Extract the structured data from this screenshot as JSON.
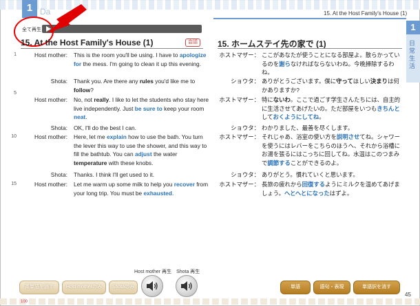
{
  "header": {
    "day_number": "1",
    "day_label": "Da",
    "play_all": "全て再生",
    "page_title_right": "15. At the Host Family's House (1)"
  },
  "side_tab": {
    "number": "1",
    "text": "日常生活"
  },
  "english": {
    "title": "15. At the Host Family's House (1)",
    "badge": "会話",
    "rows": [
      {
        "ln": "1",
        "speaker": "Host mother:",
        "t1": "This is the room you'll be using. I have to ",
        "t2": "apologize for",
        "t3": " the mess. I'm going to clean it up this evening."
      },
      {
        "ln": "",
        "speaker": "Shota:",
        "t1": "Thank you. Are there any ",
        "t2": "rules",
        "t3": " you'd like me to ",
        "t4": "follow",
        "t5": "?"
      },
      {
        "ln": "5",
        "speaker": "Host mother:",
        "t1": "No, not ",
        "t2": "really",
        "t3": ". I like to let the students who stay here live independently. Just ",
        "t4": "be sure to",
        "t5": " keep your room ",
        "t6": "neat",
        "t7": "."
      },
      {
        "ln": "",
        "speaker": "Shota:",
        "t1": "OK, I'll do the best I can."
      },
      {
        "ln": "10",
        "speaker": "Host mother:",
        "t1": "Here, let me ",
        "t2": "explain",
        "t3": " how to use the bath. You turn the lever this way to use the shower, and this way to fill the bathtub. You can ",
        "t4": "adjust",
        "t5": " the water ",
        "t6": "temperature",
        "t7": " with these knobs."
      },
      {
        "ln": "",
        "speaker": "Shota:",
        "t1": "Thanks. I think I'll get used to it."
      },
      {
        "ln": "15",
        "speaker": "Host mother:",
        "t1": "Let me warm up some milk to help you ",
        "t2": "recover",
        "t3": " from your long trip. You must be ",
        "t4": "exhausted",
        "t5": "."
      }
    ]
  },
  "japanese": {
    "title": "15. ホームステイ先の家で (1)",
    "rows": [
      {
        "speaker": "ホストマザー：",
        "t1": "ここがあなたが使うことになる部屋よ。散らかっているのを",
        "t2": "謝ら",
        "t3": "なければならないわね。今晩掃除するわね。"
      },
      {
        "speaker": "ショウタ：",
        "t1": "ありがとうございます。僕に",
        "t2": "守って",
        "t3": "ほしい",
        "t4": "決まり",
        "t5": "は何かありますか?"
      },
      {
        "speaker": "ホストマザー：",
        "t1": "特に",
        "t2": "ないわ",
        "t3": "。ここで過ごす学生さんたちには、自主的に生活させてあげたいの。ただ部屋をいつも",
        "t4": "きちんと",
        "t5": "して",
        "t6": "おくようにしてね",
        "t7": "。"
      },
      {
        "speaker": "ショウタ：",
        "t1": "わかりました、最善を尽くします。"
      },
      {
        "speaker": "ホストマザー：",
        "t1": "それじゃあ、浴室の使い方を",
        "t2": "説明させ",
        "t3": "てね。シャワーを使うにはレバーをこちらのほうへ、それから浴槽にお湯を張るにはこっちに回してね。水温はこのつまみで",
        "t4": "調節する",
        "t5": "ことができるのよ。"
      },
      {
        "speaker": "ショウタ：",
        "t1": "ありがとう。慣れていくと思います。"
      },
      {
        "speaker": "ホストマザー：",
        "t1": "長旅の疲れから",
        "t2": "回復する",
        "t3": "ようにミルクを温めてあげましょう。",
        "t4": "へとへとになった",
        "t5": "はずよ。"
      }
    ]
  },
  "bottom": {
    "caption": "Host mother 再生　Shota 再生",
    "buttons_left": [
      "英単語を消す",
      "Host motherのみ",
      "Shotaのみ"
    ],
    "buttons_right": [
      "単語",
      "語句・表現",
      "単語訳を消す"
    ],
    "page_left": "100",
    "page_right": "45"
  },
  "icons": {
    "speaker": "speaker-icon",
    "play": "play-icon"
  },
  "colors": {
    "accent_blue": "#6b9bd0",
    "highlight_blue": "#2a72b8",
    "annotation_red": "#e00000",
    "button_gold": "#b47d22"
  }
}
